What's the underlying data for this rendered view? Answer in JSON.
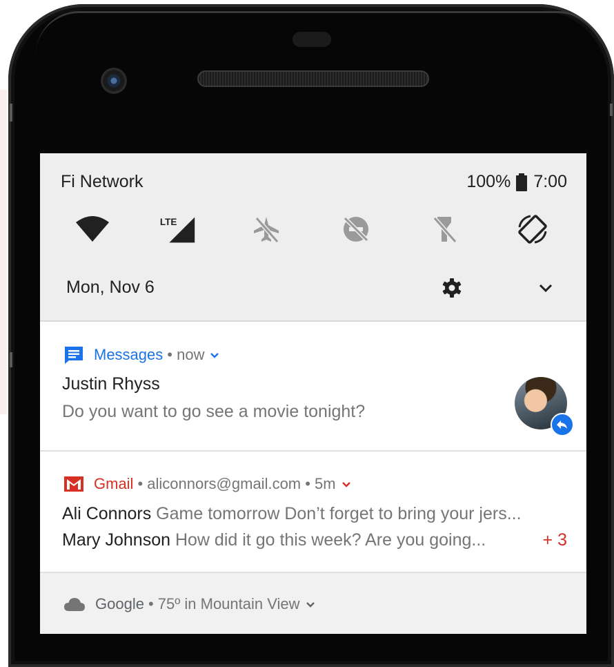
{
  "status_bar": {
    "carrier": "Fi Network",
    "battery": "100%",
    "time": "7:00"
  },
  "quick_settings": {
    "tiles": [
      {
        "icon": "wifi-icon",
        "state": "on"
      },
      {
        "icon": "lte-signal-icon",
        "label": "LTE",
        "state": "on"
      },
      {
        "icon": "airplane-mode-off-icon",
        "state": "off"
      },
      {
        "icon": "do-not-disturb-off-icon",
        "state": "off"
      },
      {
        "icon": "flashlight-off-icon",
        "state": "off"
      },
      {
        "icon": "auto-rotate-icon",
        "state": "on"
      }
    ],
    "date": "Mon, Nov 6",
    "settings_icon": "gear-icon",
    "expand_icon": "chevron-down-icon"
  },
  "notifications": [
    {
      "app": "Messages",
      "meta": "• now",
      "accent": "#1a73e8",
      "title": "Justin Rhyss",
      "text": "Do you want to go see a movie tonight?",
      "avatar_icon": "avatar",
      "badge_icon": "reply-icon"
    },
    {
      "app": "Gmail",
      "meta": "• aliconnors@gmail.com • 5m",
      "accent": "#d93025",
      "lines": [
        {
          "sender": "Ali Connors",
          "text": " Game tomorrow Don’t forget to bring your jers..."
        },
        {
          "sender": "Mary Johnson",
          "text": " How did it go this week? Are you going..."
        }
      ],
      "more": "+ 3"
    },
    {
      "app": "Google",
      "meta": "• 75º in Mountain View",
      "icon": "cloud-icon"
    }
  ]
}
